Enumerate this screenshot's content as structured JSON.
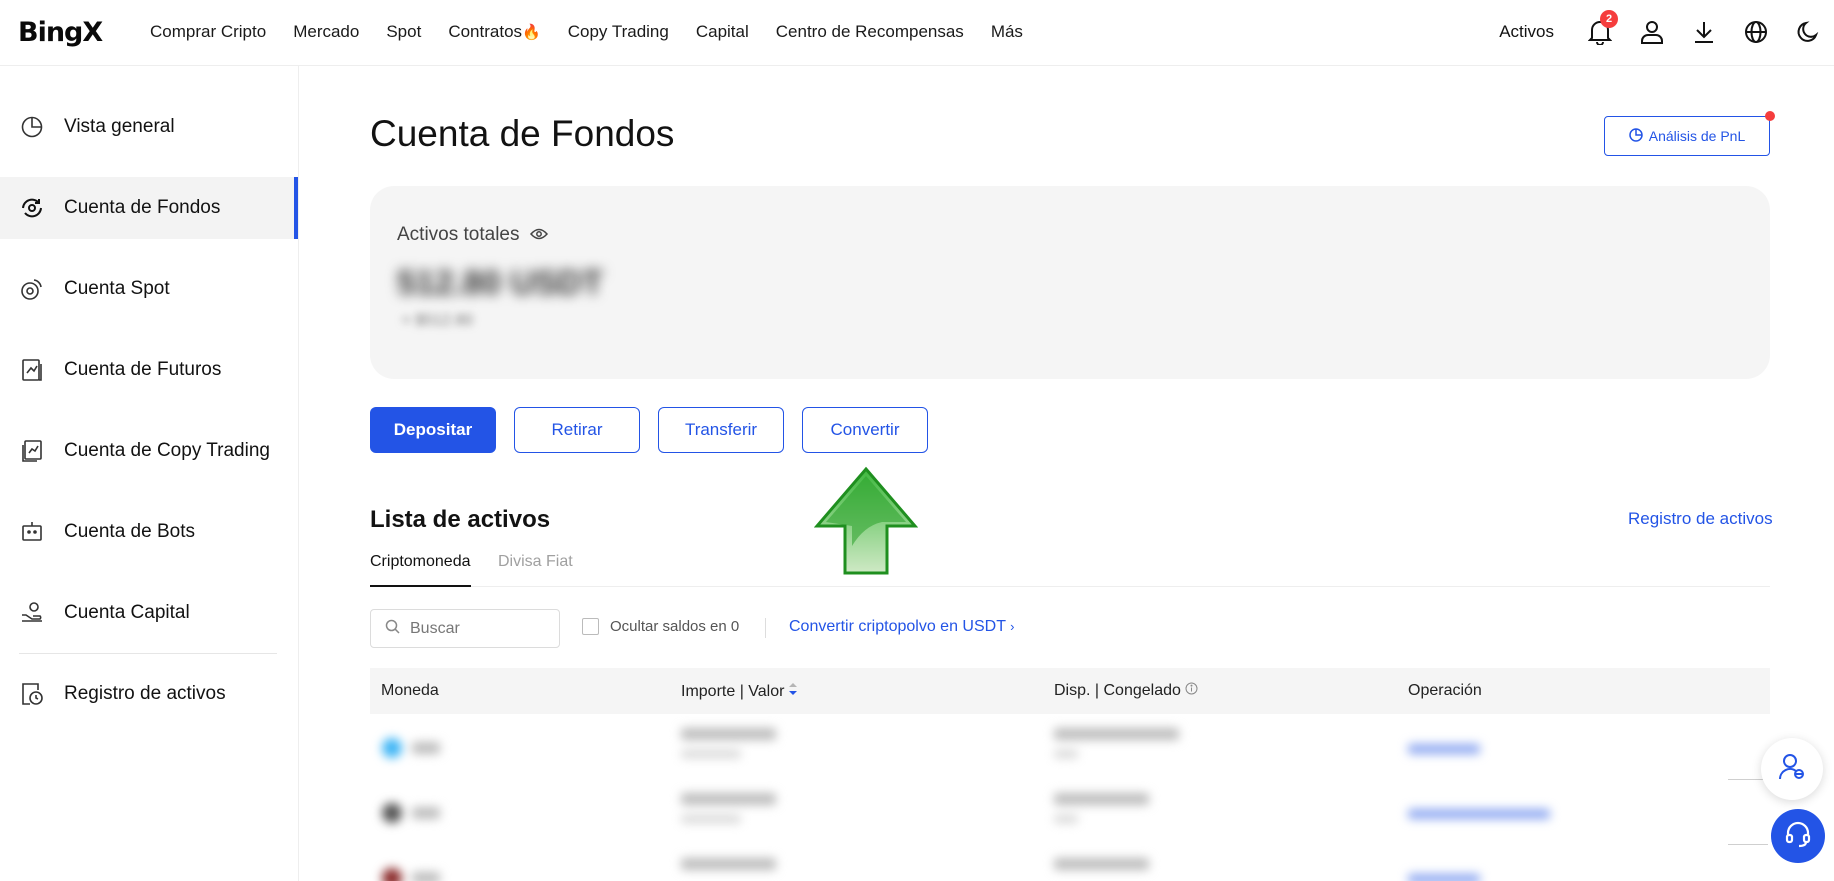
{
  "nav": {
    "logo": "BingX",
    "links": [
      "Comprar Cripto",
      "Mercado",
      "Spot",
      "Contratos",
      "Copy Trading",
      "Capital",
      "Centro de Recompensas",
      "Más"
    ],
    "activos": "Activos",
    "notification_count": "2"
  },
  "sidebar": {
    "items": [
      {
        "label": "Vista general",
        "icon": "pie-chart-icon"
      },
      {
        "label": "Cuenta de Fondos",
        "icon": "funds-icon"
      },
      {
        "label": "Cuenta Spot",
        "icon": "spot-icon"
      },
      {
        "label": "Cuenta de Futuros",
        "icon": "futures-icon"
      },
      {
        "label": "Cuenta de Copy Trading",
        "icon": "copy-trading-icon"
      },
      {
        "label": "Cuenta de Bots",
        "icon": "bot-icon"
      },
      {
        "label": "Cuenta Capital",
        "icon": "capital-icon"
      },
      {
        "label": "Registro de activos",
        "icon": "history-icon"
      }
    ],
    "active_index": 1
  },
  "main": {
    "title": "Cuenta de Fondos",
    "pnl_button": "Análisis de PnL",
    "asset_card": {
      "label": "Activos totales",
      "value": "512.80 USDT",
      "sub_value": "≈ $512.80"
    },
    "actions": {
      "deposit": "Depositar",
      "withdraw": "Retirar",
      "transfer": "Transferir",
      "convert": "Convertir"
    },
    "list_title": "Lista de activos",
    "registro_link": "Registro de activos",
    "tabs": [
      "Criptomoneda",
      "Divisa Fiat"
    ],
    "search_placeholder": "Buscar",
    "hide_zero_label": "Ocultar saldos en 0",
    "convert_dust_link": "Convertir criptopolvo en USDT",
    "table": {
      "headers": [
        "Moneda",
        "Importe | Valor",
        "Disp. | Congelado",
        "Operación"
      ]
    }
  },
  "colors": {
    "accent": "#2354e6",
    "alert": "#f53d3d",
    "arrow_green": "#2aa12a"
  }
}
